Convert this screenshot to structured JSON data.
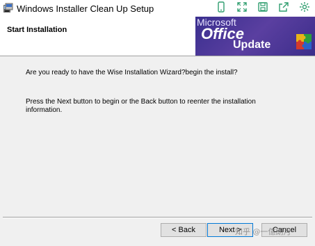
{
  "window": {
    "title": "Windows Installer Clean Up Setup"
  },
  "overlay_toolbar": {
    "icons": [
      "phone-icon",
      "fullscreen-icon",
      "save-icon",
      "share-icon",
      "settings-icon"
    ],
    "color": "#2e9d6e"
  },
  "header": {
    "title": "Start Installation",
    "banner": {
      "line1": "Microsoft",
      "line2": "Office",
      "line3": "Update",
      "color": "#4a3899"
    }
  },
  "content": {
    "paragraph1": "Are you ready to have the Wise Installation Wizard?begin the install?",
    "paragraph2": "Press the Next button to begin or the Back button to reenter the installation information."
  },
  "buttons": {
    "back": "< Back",
    "next": "Next >",
    "cancel": "Cancel"
  },
  "watermark": "知乎 @一億朗月"
}
